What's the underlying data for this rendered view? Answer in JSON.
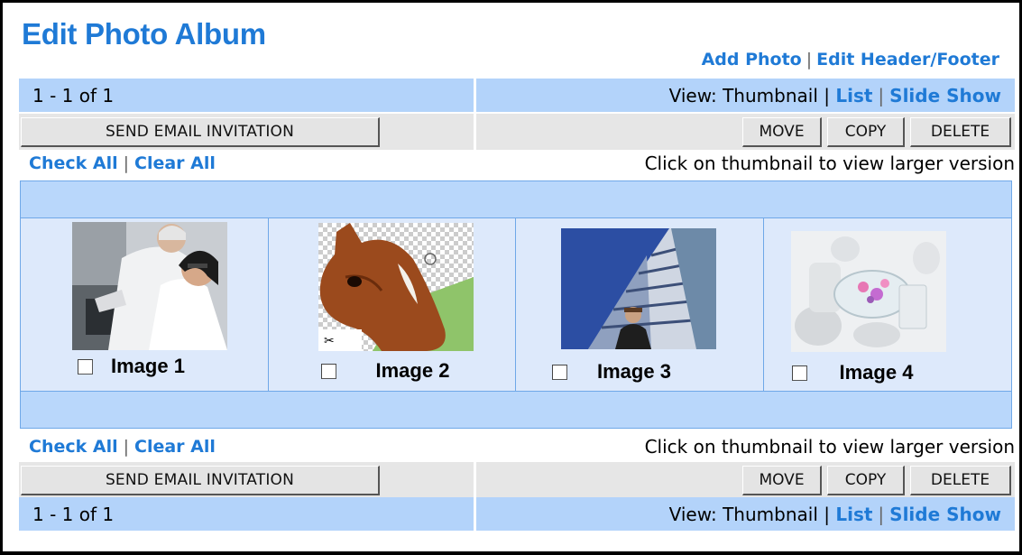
{
  "page": {
    "title": "Edit Photo Album",
    "add_photo": "Add Photo",
    "edit_header_footer": "Edit Header/Footer",
    "sep": "|"
  },
  "pager": {
    "range": "1 - 1 of 1",
    "view_label": "View: Thumbnail |",
    "list": "List",
    "slide_show": "Slide Show",
    "sep": "|"
  },
  "actions": {
    "send_email": "SEND EMAIL INVITATION",
    "move": "MOVE",
    "copy": "COPY",
    "delete": "DELETE"
  },
  "selection": {
    "check_all": "Check All",
    "clear_all": "Clear All",
    "hint": "Click on thumbnail to view larger version"
  },
  "images": [
    {
      "caption": "Image 1",
      "icon": "scientists-photo",
      "checked": false
    },
    {
      "caption": "Image 2",
      "icon": "horse-photo",
      "checked": false
    },
    {
      "caption": "Image 3",
      "icon": "businessman-building-photo",
      "checked": false
    },
    {
      "caption": "Image 4",
      "icon": "glass-tea-set-photo",
      "checked": false
    }
  ],
  "colors": {
    "accent": "#1f7ad6",
    "bar": "#b3d3fa",
    "grid": "#6fa8e8"
  }
}
